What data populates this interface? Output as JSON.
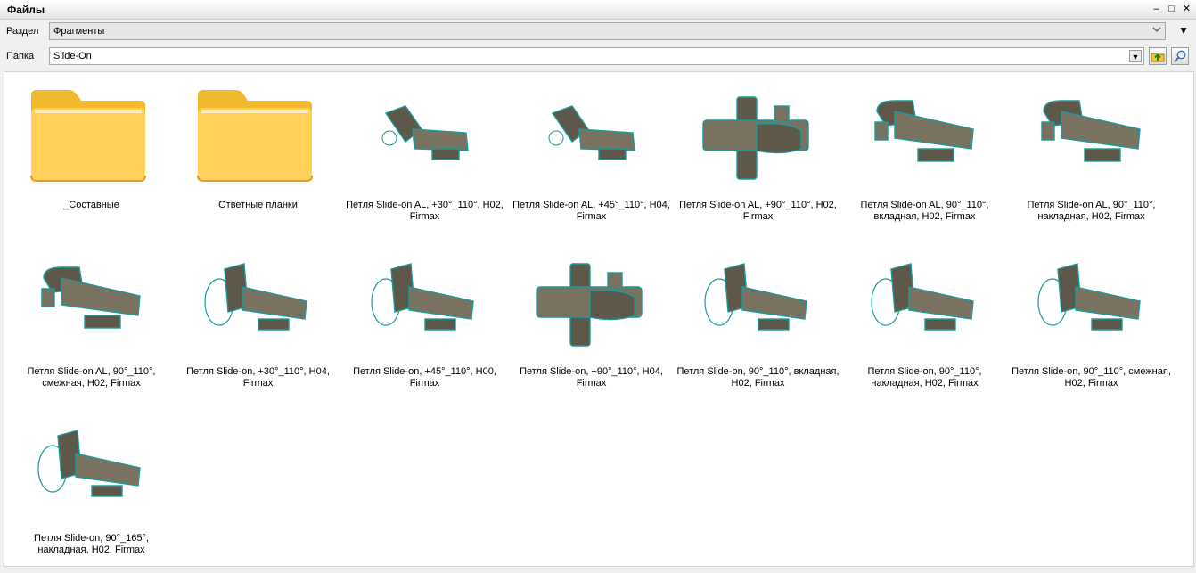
{
  "window": {
    "title": "Файлы",
    "btn_min": "–",
    "btn_max": "□",
    "btn_close": "✕"
  },
  "section": {
    "label": "Раздел",
    "value": "Фрагменты"
  },
  "folder": {
    "label": "Папка",
    "value": "Slide-On"
  },
  "items": [
    {
      "kind": "folder",
      "name": "_Составные"
    },
    {
      "kind": "folder",
      "name": "Ответные планки"
    },
    {
      "kind": "hinge",
      "variant": "angled",
      "name": "Петля Slide-on AL, +30°_110°, H02, Firmax"
    },
    {
      "kind": "hinge",
      "variant": "angled",
      "name": "Петля Slide-on AL, +45°_110°, H04, Firmax"
    },
    {
      "kind": "hinge",
      "variant": "cross",
      "name": "Петля Slide-on AL, +90°_110°, H02, Firmax"
    },
    {
      "kind": "hinge",
      "variant": "straight",
      "name": "Петля Slide-on AL, 90°_110°, вкладная, H02, Firmax"
    },
    {
      "kind": "hinge",
      "variant": "straight",
      "name": "Петля Slide-on AL, 90°_110°, накладная, H02, Firmax"
    },
    {
      "kind": "hinge",
      "variant": "straight",
      "name": "Петля Slide-on AL, 90°_110°, смежная, H02, Firmax"
    },
    {
      "kind": "hinge",
      "variant": "cup",
      "name": "Петля Slide-on, +30°_110°, H04, Firmax"
    },
    {
      "kind": "hinge",
      "variant": "cup",
      "name": "Петля Slide-on, +45°_110°, H00, Firmax"
    },
    {
      "kind": "hinge",
      "variant": "cross",
      "name": "Петля Slide-on, +90°_110°, H04, Firmax"
    },
    {
      "kind": "hinge",
      "variant": "cup",
      "name": "Петля Slide-on, 90°_110°, вкладная, H02, Firmax"
    },
    {
      "kind": "hinge",
      "variant": "cup",
      "name": "Петля Slide-on, 90°_110°, накладная, H02, Firmax"
    },
    {
      "kind": "hinge",
      "variant": "cup",
      "name": "Петля Slide-on, 90°_110°, смежная, H02, Firmax"
    },
    {
      "kind": "hinge",
      "variant": "cup",
      "name": "Петля Slide-on, 90°_165°, накладная, H02, Firmax"
    }
  ],
  "colors": {
    "folder": "#ffd05a",
    "hinge_body": "#7a7260",
    "hinge_edge": "#1a9a9a"
  }
}
